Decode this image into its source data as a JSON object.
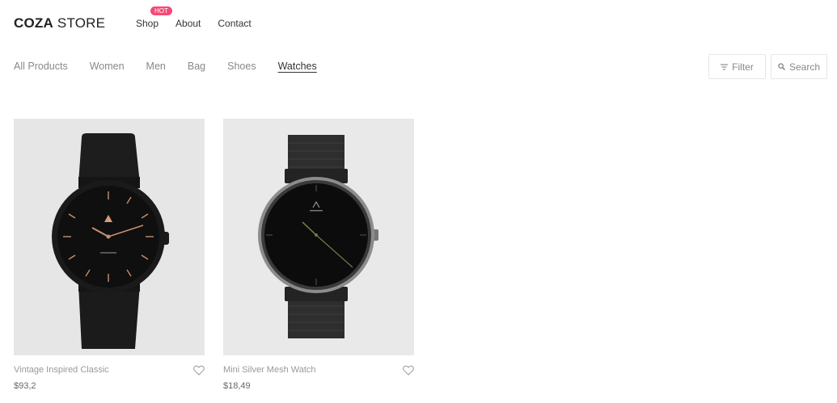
{
  "header": {
    "logo_bold": "COZA",
    "logo_light": "STORE",
    "nav": [
      {
        "label": "Shop",
        "badge": "HOT"
      },
      {
        "label": "About"
      },
      {
        "label": "Contact"
      }
    ]
  },
  "filters": {
    "categories": [
      {
        "label": "All Products",
        "active": false
      },
      {
        "label": "Women",
        "active": false
      },
      {
        "label": "Men",
        "active": false
      },
      {
        "label": "Bag",
        "active": false
      },
      {
        "label": "Shoes",
        "active": false
      },
      {
        "label": "Watches",
        "active": true
      }
    ],
    "filter_label": "Filter",
    "search_label": "Search"
  },
  "products": [
    {
      "name": "Vintage Inspired Classic",
      "price": "$93,2",
      "icon": "heart-icon"
    },
    {
      "name": "Mini Silver Mesh Watch",
      "price": "$18,49",
      "icon": "heart-icon"
    }
  ],
  "colors": {
    "badge": "#f74877",
    "image_bg_1": "#e6e6e6",
    "image_bg_2": "#e9e9e9"
  }
}
